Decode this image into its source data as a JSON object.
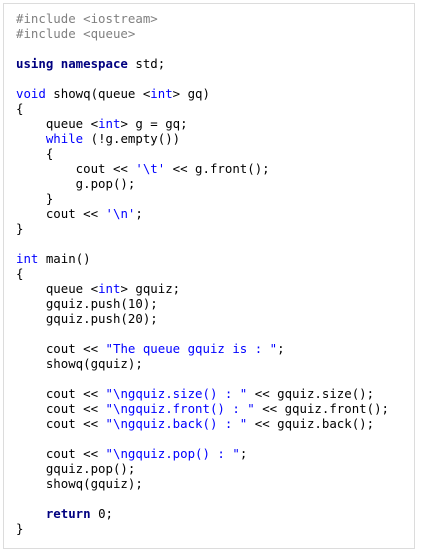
{
  "code": {
    "lines": [
      {
        "segments": [
          {
            "t": "#include <iostream>",
            "c": "preproc"
          }
        ]
      },
      {
        "segments": [
          {
            "t": "#include <queue>",
            "c": "preproc"
          }
        ]
      },
      {
        "segments": []
      },
      {
        "segments": [
          {
            "t": "using namespace",
            "c": "namespace"
          },
          {
            "t": " std;",
            "c": "plain"
          }
        ]
      },
      {
        "segments": []
      },
      {
        "segments": [
          {
            "t": "void",
            "c": "keyword"
          },
          {
            "t": " showq(queue <",
            "c": "plain"
          },
          {
            "t": "int",
            "c": "keyword"
          },
          {
            "t": "> gq)",
            "c": "plain"
          }
        ]
      },
      {
        "segments": [
          {
            "t": "{",
            "c": "plain"
          }
        ]
      },
      {
        "segments": [
          {
            "t": "    queue <",
            "c": "plain"
          },
          {
            "t": "int",
            "c": "keyword"
          },
          {
            "t": "> g = gq;",
            "c": "plain"
          }
        ]
      },
      {
        "segments": [
          {
            "t": "    ",
            "c": "plain"
          },
          {
            "t": "while",
            "c": "keyword"
          },
          {
            "t": " (!g.empty())",
            "c": "plain"
          }
        ]
      },
      {
        "segments": [
          {
            "t": "    {",
            "c": "plain"
          }
        ]
      },
      {
        "segments": [
          {
            "t": "        cout << ",
            "c": "plain"
          },
          {
            "t": "'\\t'",
            "c": "string"
          },
          {
            "t": " << g.front();",
            "c": "plain"
          }
        ]
      },
      {
        "segments": [
          {
            "t": "        g.pop();",
            "c": "plain"
          }
        ]
      },
      {
        "segments": [
          {
            "t": "    }",
            "c": "plain"
          }
        ]
      },
      {
        "segments": [
          {
            "t": "    cout << ",
            "c": "plain"
          },
          {
            "t": "'\\n'",
            "c": "string"
          },
          {
            "t": ";",
            "c": "plain"
          }
        ]
      },
      {
        "segments": [
          {
            "t": "}",
            "c": "plain"
          }
        ]
      },
      {
        "segments": []
      },
      {
        "segments": [
          {
            "t": "int",
            "c": "keyword"
          },
          {
            "t": " main()",
            "c": "plain"
          }
        ]
      },
      {
        "segments": [
          {
            "t": "{",
            "c": "plain"
          }
        ]
      },
      {
        "segments": [
          {
            "t": "    queue <",
            "c": "plain"
          },
          {
            "t": "int",
            "c": "keyword"
          },
          {
            "t": "> gquiz;",
            "c": "plain"
          }
        ]
      },
      {
        "segments": [
          {
            "t": "    gquiz.push(10);",
            "c": "plain"
          }
        ]
      },
      {
        "segments": [
          {
            "t": "    gquiz.push(20);",
            "c": "plain"
          }
        ]
      },
      {
        "segments": []
      },
      {
        "segments": [
          {
            "t": "    cout << ",
            "c": "plain"
          },
          {
            "t": "\"The queue gquiz is : \"",
            "c": "string"
          },
          {
            "t": ";",
            "c": "plain"
          }
        ]
      },
      {
        "segments": [
          {
            "t": "    showq(gquiz);",
            "c": "plain"
          }
        ]
      },
      {
        "segments": []
      },
      {
        "segments": [
          {
            "t": "    cout << ",
            "c": "plain"
          },
          {
            "t": "\"\\ngquiz.size() : \"",
            "c": "string"
          },
          {
            "t": " << gquiz.size();",
            "c": "plain"
          }
        ]
      },
      {
        "segments": [
          {
            "t": "    cout << ",
            "c": "plain"
          },
          {
            "t": "\"\\ngquiz.front() : \"",
            "c": "string"
          },
          {
            "t": " << gquiz.front();",
            "c": "plain"
          }
        ]
      },
      {
        "segments": [
          {
            "t": "    cout << ",
            "c": "plain"
          },
          {
            "t": "\"\\ngquiz.back() : \"",
            "c": "string"
          },
          {
            "t": " << gquiz.back();",
            "c": "plain"
          }
        ]
      },
      {
        "segments": []
      },
      {
        "segments": [
          {
            "t": "    cout << ",
            "c": "plain"
          },
          {
            "t": "\"\\ngquiz.pop() : \"",
            "c": "string"
          },
          {
            "t": ";",
            "c": "plain"
          }
        ]
      },
      {
        "segments": [
          {
            "t": "    gquiz.pop();",
            "c": "plain"
          }
        ]
      },
      {
        "segments": [
          {
            "t": "    showq(gquiz);",
            "c": "plain"
          }
        ]
      },
      {
        "segments": []
      },
      {
        "segments": [
          {
            "t": "    ",
            "c": "plain"
          },
          {
            "t": "return",
            "c": "return"
          },
          {
            "t": " 0;",
            "c": "plain"
          }
        ]
      },
      {
        "segments": [
          {
            "t": "}",
            "c": "plain"
          }
        ]
      }
    ]
  },
  "colors": {
    "background": "#ffffff",
    "border": "#dcdcdc",
    "preprocessor": "#808080",
    "keyword": "#0000ff",
    "bold_keyword": "#000080",
    "string": "#0000ff",
    "text": "#000000"
  }
}
